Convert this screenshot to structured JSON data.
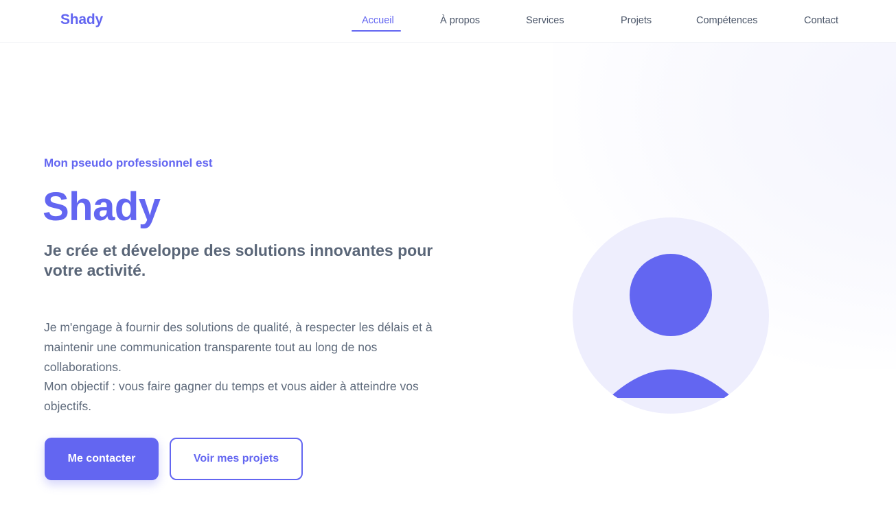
{
  "brand": {
    "logo": "Shady",
    "accent_color": "#6366f1"
  },
  "nav": {
    "items": [
      {
        "label": "Accueil",
        "active": true
      },
      {
        "label": "À propos",
        "active": false
      },
      {
        "label": "Services",
        "active": false
      },
      {
        "label": "Projets",
        "active": false
      },
      {
        "label": "Compétences",
        "active": false
      },
      {
        "label": "Contact",
        "active": false
      }
    ]
  },
  "hero": {
    "eyebrow": "Mon pseudo professionnel est",
    "name": "Shady",
    "tagline": "Je crée et développe des solutions innovantes pour votre activité.",
    "description_line1": "Je m'engage à fournir des solutions de qualité, à respecter les délais et à maintenir une communication transparente tout au long de nos collaborations.",
    "description_line2": "Mon objectif : vous faire gagner du temps et vous aider à atteindre vos objectifs.",
    "primary_button": "Me contacter",
    "secondary_button": "Voir mes projets",
    "avatar_icon": "user-avatar-icon"
  }
}
